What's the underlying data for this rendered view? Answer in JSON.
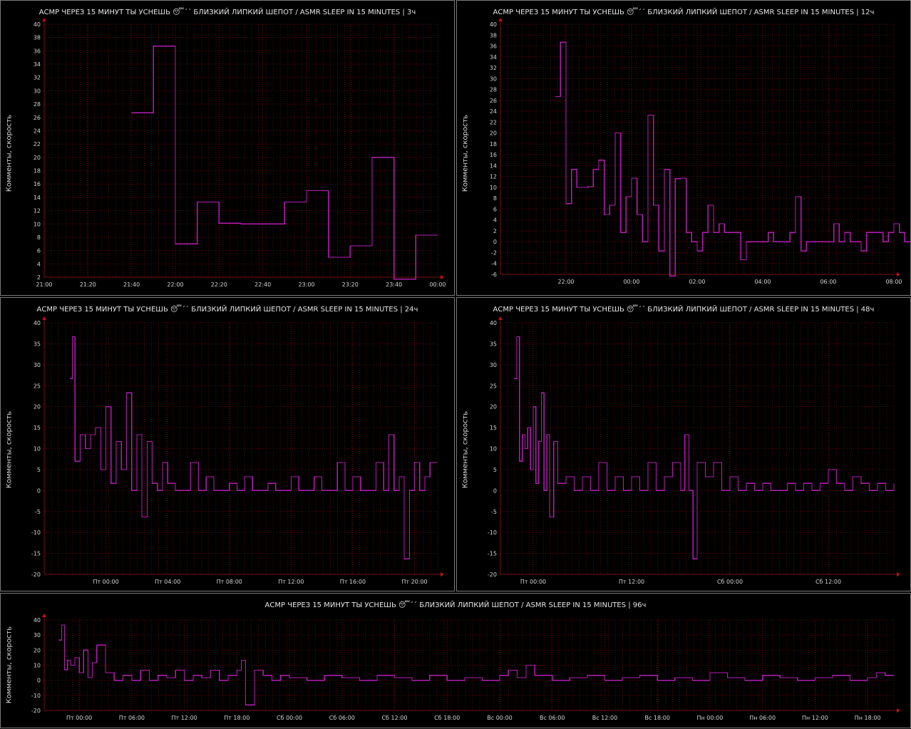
{
  "colors": {
    "background": "#000000",
    "grid": "#5a0a0a",
    "line": "#b41eb4",
    "axis": "#7a1010",
    "border": "#7a7a7a"
  },
  "chart_data": [
    {
      "type": "line",
      "step": true,
      "title": "АСМР ЧЕРЕЗ 15 МИНУТ ТЫ УСНЕШЬ 😴´´ БЛИЗКИЙ ЛИПКИЙ ШЕПОТ / ASMR SLEEP IN 15 MINUTES | 3ч",
      "ylabel": "Комменты, скорость",
      "ylim": [
        2,
        40
      ],
      "yticks": [
        2,
        4,
        6,
        8,
        10,
        12,
        14,
        16,
        18,
        20,
        22,
        24,
        26,
        28,
        30,
        32,
        34,
        36,
        38,
        40
      ],
      "xlim": [
        0,
        180
      ],
      "xticks": [
        {
          "x": 0,
          "label": "21:00"
        },
        {
          "x": 20,
          "label": "21:20"
        },
        {
          "x": 40,
          "label": "21:40"
        },
        {
          "x": 60,
          "label": "22:00"
        },
        {
          "x": 80,
          "label": "22:20"
        },
        {
          "x": 100,
          "label": "22:40"
        },
        {
          "x": 120,
          "label": "23:00"
        },
        {
          "x": 140,
          "label": "23:20"
        },
        {
          "x": 160,
          "label": "23:40"
        },
        {
          "x": 180,
          "label": "00:00"
        }
      ],
      "x": [
        40,
        50,
        60,
        70,
        80,
        90,
        100,
        110,
        120,
        130,
        140,
        150,
        160,
        170,
        180
      ],
      "values": [
        26.7,
        36.7,
        7,
        13.3,
        10.1,
        10,
        10,
        13.3,
        15,
        5,
        6.7,
        20,
        1.7,
        8.3,
        8.3
      ]
    },
    {
      "type": "line",
      "step": true,
      "title": "АСМР ЧЕРЕЗ 15 МИНУТ ТЫ УСНЕШЬ 😴´´ БЛИЗКИЙ ЛИПКИЙ ШЕПОТ / ASMR SLEEP IN 15 MINUTES | 12ч",
      "ylabel": "Комменты, скорость",
      "ylim": [
        -6,
        40
      ],
      "yticks": [
        -6,
        -4,
        -2,
        0,
        2,
        4,
        6,
        8,
        10,
        12,
        14,
        16,
        18,
        20,
        22,
        24,
        26,
        28,
        30,
        32,
        34,
        36,
        38,
        40
      ],
      "xlim": [
        -2,
        10
      ],
      "xticks": [
        {
          "x": 0,
          "label": "22:00"
        },
        {
          "x": 2,
          "label": "00:00"
        },
        {
          "x": 4,
          "label": "02:00"
        },
        {
          "x": 6,
          "label": "04:00"
        },
        {
          "x": 8,
          "label": "06:00"
        },
        {
          "x": 10,
          "label": "08:00"
        }
      ],
      "x": [
        -0.33,
        -0.17,
        0,
        0.17,
        0.33,
        0.5,
        0.67,
        0.83,
        1,
        1.17,
        1.33,
        1.5,
        1.67,
        1.83,
        2,
        2.17,
        2.33,
        2.5,
        2.67,
        2.83,
        3,
        3.17,
        3.33,
        3.5,
        3.67,
        3.83,
        4,
        4.17,
        4.33,
        4.5,
        4.67,
        4.83,
        5,
        5.17,
        5.33,
        5.5,
        5.67,
        5.83,
        6,
        6.17,
        6.33,
        6.5,
        6.67,
        6.83,
        7,
        7.17,
        7.33,
        7.5,
        7.67,
        7.83,
        8,
        8.17,
        8.33,
        8.5,
        8.67,
        8.83,
        9,
        9.17,
        9.33,
        9.5,
        9.67,
        9.83,
        10,
        10.17,
        10.33,
        10.5,
        10.67,
        10.83,
        11
      ],
      "values": [
        26.7,
        36.7,
        7,
        13.3,
        10,
        10,
        10.1,
        13.3,
        15,
        5,
        6.7,
        20,
        1.7,
        8.3,
        11.7,
        5,
        0,
        23.3,
        6.7,
        -1.7,
        13.3,
        -6.3,
        11.6,
        11.7,
        1.7,
        0,
        -1.7,
        1.7,
        6.7,
        1.7,
        3.3,
        1.7,
        1.7,
        1.7,
        -3.3,
        0,
        0,
        0,
        0,
        1.7,
        0,
        0,
        0,
        1.7,
        8.3,
        -1.7,
        0,
        0,
        0,
        0,
        0,
        3.3,
        0,
        1.7,
        0,
        0,
        -1.7,
        1.7,
        1.7,
        1.7,
        0,
        1.7,
        3.3,
        1.7,
        0,
        0,
        5,
        0,
        0
      ]
    },
    {
      "type": "line",
      "step": true,
      "title": "АСМР ЧЕРЕЗ 15 МИНУТ ТЫ УСНЕШЬ 😴´´ БЛИЗКИЙ ЛИПКИЙ ШЕПОТ / ASMR SLEEP IN 15 MINUTES | 24ч",
      "ylabel": "Комменты, скорость",
      "ylim": [
        -20,
        40
      ],
      "yticks": [
        -20,
        -15,
        -10,
        -5,
        0,
        5,
        10,
        15,
        20,
        25,
        30,
        35,
        40
      ],
      "xlim": [
        -4,
        21.5
      ],
      "xticks": [
        {
          "x": 0,
          "label": "Пт 00:00"
        },
        {
          "x": 4,
          "label": "Пт 04:00"
        },
        {
          "x": 8,
          "label": "Пт 08:00"
        },
        {
          "x": 12,
          "label": "Пт 12:00"
        },
        {
          "x": 16,
          "label": "Пт 16:00"
        },
        {
          "x": 20,
          "label": "Пт 20:00"
        }
      ],
      "x": [
        -2.33,
        -2.17,
        -2,
        -1.67,
        -1.33,
        -1,
        -0.67,
        -0.33,
        0,
        0.33,
        0.67,
        1,
        1.33,
        1.67,
        2,
        2.33,
        2.67,
        3,
        3.33,
        3.67,
        4,
        4.5,
        5,
        5.5,
        6,
        6.5,
        7,
        7.5,
        8,
        8.5,
        9,
        9.5,
        10,
        10.5,
        11,
        11.5,
        12,
        12.5,
        13,
        13.5,
        14,
        14.5,
        15,
        15.5,
        16,
        16.5,
        17,
        17.5,
        18,
        18.33,
        18.67,
        19,
        19.33,
        19.67,
        20,
        20.33,
        20.67,
        21,
        21.5
      ],
      "values": [
        26.7,
        36.7,
        7,
        13.3,
        10,
        13.3,
        15,
        5,
        20,
        1.7,
        11.7,
        5,
        23.3,
        0,
        13.3,
        -6.3,
        11.7,
        1.7,
        0,
        6.7,
        1.7,
        0,
        0,
        6.7,
        0,
        3.3,
        0,
        0,
        1.7,
        0,
        3.3,
        0,
        0,
        1.7,
        0,
        0,
        3.3,
        0,
        0,
        3.3,
        0,
        0,
        6.7,
        0,
        3.3,
        0,
        0,
        6.7,
        0,
        13.3,
        0,
        3.3,
        -16.3,
        0,
        6.7,
        0,
        3.3,
        6.7,
        6.7
      ]
    },
    {
      "type": "line",
      "step": true,
      "title": "АСМР ЧЕРЕЗ 15 МИНУТ ТЫ УСНЕШЬ 😴´´ БЛИЗКИЙ ЛИПКИЙ ШЕПОТ / ASMR SLEEP IN 15 MINUTES | 48ч",
      "ylabel": "Комменты, скорость",
      "ylim": [
        -20,
        40
      ],
      "yticks": [
        -20,
        -15,
        -10,
        -5,
        0,
        5,
        10,
        15,
        20,
        25,
        30,
        35,
        40
      ],
      "xlim": [
        -4,
        44
      ],
      "xticks": [
        {
          "x": 0,
          "label": "Пт 00:00"
        },
        {
          "x": 12,
          "label": "Пт 12:00"
        },
        {
          "x": 24,
          "label": "Сб 00:00"
        },
        {
          "x": 36,
          "label": "Сб 12:00"
        }
      ],
      "x": [
        -2.33,
        -2,
        -1.67,
        -1.33,
        -1,
        -0.67,
        -0.33,
        0,
        0.33,
        0.67,
        1,
        1.33,
        1.67,
        2,
        2.5,
        3,
        4,
        5,
        6,
        7,
        8,
        9,
        10,
        11,
        12,
        13,
        14,
        15,
        16,
        17,
        18,
        18.5,
        19,
        19.5,
        20,
        21,
        22,
        23,
        24,
        25,
        26,
        27,
        28,
        29,
        30,
        31,
        32,
        33,
        34,
        35,
        36,
        37,
        38,
        39,
        40,
        41,
        42,
        43,
        44
      ],
      "values": [
        26.7,
        36.7,
        7,
        13.3,
        10,
        15,
        5,
        20,
        1.7,
        11.7,
        23.3,
        0,
        13.3,
        -6.3,
        11.7,
        1.7,
        3.3,
        0,
        3.3,
        0,
        6.7,
        0,
        3.3,
        0,
        3.3,
        0,
        6.7,
        0,
        3.3,
        6.7,
        0,
        13.3,
        0,
        -16.3,
        6.7,
        3.3,
        6.7,
        0,
        3.3,
        0,
        1.7,
        0,
        1.7,
        0,
        0,
        1.7,
        0,
        1.7,
        0,
        1.7,
        5,
        1.7,
        0,
        3.3,
        1.7,
        0,
        1.7,
        0,
        1.7
      ]
    },
    {
      "type": "line",
      "step": true,
      "title": "АСМР ЧЕРЕЗ 15 МИНУТ ТЫ УСНЕШЬ 😴´´ БЛИЗКИЙ ЛИПКИЙ ШЕПОТ / ASMR SLEEP IN 15 MINUTES | 96ч",
      "ylabel": "Комменты, скорость",
      "ylim": [
        -20,
        40
      ],
      "yticks": [
        -20,
        -10,
        0,
        10,
        20,
        30,
        40
      ],
      "xlim": [
        -4,
        93
      ],
      "xticks": [
        {
          "x": 0,
          "label": "Пт 00:00"
        },
        {
          "x": 6,
          "label": "Пт 06:00"
        },
        {
          "x": 12,
          "label": "Пт 12:00"
        },
        {
          "x": 18,
          "label": "Пт 18:00"
        },
        {
          "x": 24,
          "label": "Сб 00:00"
        },
        {
          "x": 30,
          "label": "Сб 06:00"
        },
        {
          "x": 36,
          "label": "Сб 12:00"
        },
        {
          "x": 42,
          "label": "Сб 18:00"
        },
        {
          "x": 48,
          "label": "Вс 00:00"
        },
        {
          "x": 54,
          "label": "Вс 06:00"
        },
        {
          "x": 60,
          "label": "Вс 12:00"
        },
        {
          "x": 66,
          "label": "Вс 18:00"
        },
        {
          "x": 72,
          "label": "Пн 00:00"
        },
        {
          "x": 78,
          "label": "Пн 06:00"
        },
        {
          "x": 84,
          "label": "Пн 12:00"
        },
        {
          "x": 90,
          "label": "Пн 18:00"
        }
      ],
      "x": [
        -2.33,
        -2,
        -1.67,
        -1.33,
        -1,
        -0.5,
        0,
        0.5,
        1,
        1.5,
        2,
        3,
        4,
        5,
        6,
        7,
        8,
        9,
        10,
        11,
        12,
        13,
        14,
        15,
        16,
        17,
        18,
        18.5,
        19,
        20,
        21,
        22,
        23,
        24,
        26,
        28,
        30,
        32,
        34,
        36,
        38,
        40,
        42,
        44,
        46,
        48,
        49,
        50,
        51,
        52,
        54,
        56,
        58,
        60,
        62,
        64,
        66,
        68,
        70,
        72,
        74,
        76,
        78,
        80,
        82,
        84,
        86,
        88,
        90,
        91,
        92,
        93
      ],
      "values": [
        26.7,
        36.7,
        7,
        13.3,
        10,
        15,
        5,
        20,
        1.7,
        11.7,
        23.3,
        5,
        0,
        3.3,
        0,
        6.7,
        0,
        3.3,
        1.7,
        6.7,
        0,
        3.3,
        1.7,
        6.7,
        0,
        3.3,
        6.7,
        13.3,
        -16.3,
        6.7,
        3.3,
        0,
        3.3,
        1.7,
        0,
        3.3,
        1.7,
        0,
        3.3,
        1.7,
        0,
        3.3,
        0,
        1.7,
        0,
        3.3,
        6.7,
        1.7,
        10,
        3.3,
        0,
        1.7,
        3.3,
        0,
        1.7,
        3.3,
        0,
        1.7,
        0,
        5,
        1.7,
        0,
        3.3,
        1.7,
        0,
        1.7,
        3.3,
        0,
        1.7,
        5,
        3.3,
        3.3
      ]
    }
  ]
}
